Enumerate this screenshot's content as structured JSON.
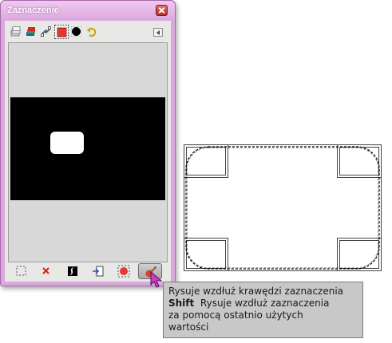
{
  "window": {
    "title": "Zaznaczenie"
  },
  "tabs": [
    {
      "icon": "layers-icon"
    },
    {
      "icon": "channels-icon"
    },
    {
      "icon": "paths-icon"
    },
    {
      "icon": "selection-editor-icon",
      "active": true
    },
    {
      "icon": "colormap-icon"
    },
    {
      "icon": "undo-history-icon"
    }
  ],
  "bottom_buttons": [
    {
      "icon": "select-all-icon"
    },
    {
      "icon": "select-none-icon"
    },
    {
      "icon": "invert-selection-icon"
    },
    {
      "icon": "save-to-channel-icon"
    },
    {
      "icon": "selection-to-path-icon"
    },
    {
      "icon": "stroke-selection-icon",
      "pressed": true
    }
  ],
  "tooltip": {
    "line1": "Rysuje wzdłuż krawędzi zaznaczenia",
    "modifier": "Shift",
    "line2": "Rysuje wzdłuż zaznaczenia",
    "line3": "za pomocą ostatnio użytych",
    "line4": "wartości"
  },
  "colors": {
    "window_frame": "#dba8dd",
    "preview_bg": "#d8d8d8",
    "tooltip_bg": "#c8c8c8",
    "cursor": "#c83cc8"
  }
}
